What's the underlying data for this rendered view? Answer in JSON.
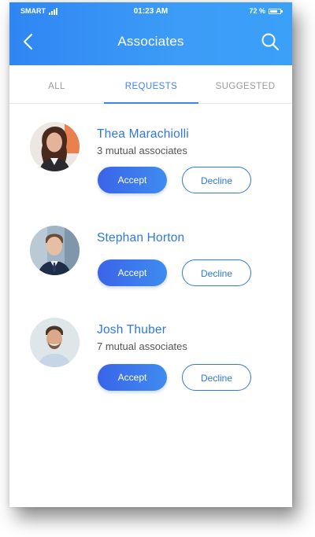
{
  "status_bar": {
    "carrier": "SMART",
    "time": "01:23 AM",
    "battery": "72 %",
    "battery_level": 0.72
  },
  "header": {
    "title": "Associates",
    "back_icon": "chevron-left-icon",
    "search_icon": "search-icon"
  },
  "tabs": [
    {
      "label": "ALL",
      "active": false
    },
    {
      "label": "REQUESTS",
      "active": true
    },
    {
      "label": "SUGGESTED",
      "active": false
    }
  ],
  "requests": [
    {
      "name": "Thea Marachiolli",
      "mutual": "3 mutual associates",
      "accept_label": "Accept",
      "decline_label": "Decline"
    },
    {
      "name": "Stephan Horton",
      "mutual": "",
      "accept_label": "Accept",
      "decline_label": "Decline"
    },
    {
      "name": "Josh Thuber",
      "mutual": "7 mutual associates",
      "accept_label": "Accept",
      "decline_label": "Decline"
    }
  ],
  "colors": {
    "header_start": "#2f86f3",
    "header_end": "#3aa0f8",
    "accent": "#2f78dc",
    "accept_start": "#3a64e8",
    "accept_end": "#3f8cf0"
  }
}
